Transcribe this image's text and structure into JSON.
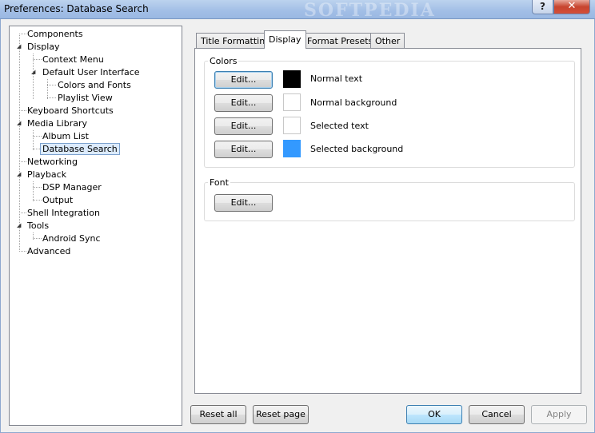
{
  "window": {
    "title": "Preferences: Database Search",
    "watermark": "SOFTPEDIA",
    "help_glyph": "?",
    "close_glyph": "✕"
  },
  "tree": {
    "items": [
      {
        "label": "Components"
      },
      {
        "label": "Display"
      },
      {
        "label": "Context Menu"
      },
      {
        "label": "Default User Interface"
      },
      {
        "label": "Colors and Fonts"
      },
      {
        "label": "Playlist View"
      },
      {
        "label": "Keyboard Shortcuts"
      },
      {
        "label": "Media Library"
      },
      {
        "label": "Album List"
      },
      {
        "label": "Database Search",
        "selected": true
      },
      {
        "label": "Networking"
      },
      {
        "label": "Playback"
      },
      {
        "label": "DSP Manager"
      },
      {
        "label": "Output"
      },
      {
        "label": "Shell Integration"
      },
      {
        "label": "Tools"
      },
      {
        "label": "Android Sync"
      },
      {
        "label": "Advanced"
      }
    ],
    "expander_glyph": "◢"
  },
  "tabs": [
    {
      "label": "Title Formatting"
    },
    {
      "label": "Display",
      "active": true
    },
    {
      "label": "Format Presets"
    },
    {
      "label": "Other"
    }
  ],
  "colors_group": {
    "label": "Colors",
    "rows": [
      {
        "button": "Edit...",
        "label": "Normal text",
        "color": "#000000"
      },
      {
        "button": "Edit...",
        "label": "Normal background",
        "color": "#ffffff"
      },
      {
        "button": "Edit...",
        "label": "Selected text",
        "color": "#ffffff"
      },
      {
        "button": "Edit...",
        "label": "Selected background",
        "color": "#3399ff"
      }
    ]
  },
  "font_group": {
    "label": "Font",
    "button": "Edit..."
  },
  "footer": {
    "reset_all": "Reset all",
    "reset_page": "Reset page",
    "ok": "OK",
    "cancel": "Cancel",
    "apply": "Apply"
  }
}
